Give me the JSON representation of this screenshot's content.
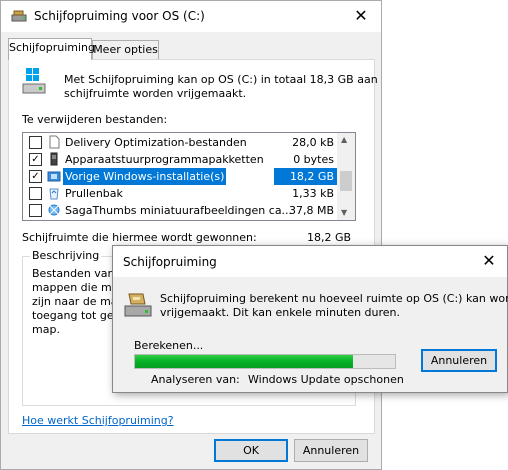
{
  "main_window": {
    "title": "Schijfopruiming voor OS (C:)",
    "tabs": [
      {
        "label": "Schijfopruiming",
        "active": true
      },
      {
        "label": "Meer opties",
        "active": false
      }
    ],
    "intro_text_line1": "Met Schijfopruiming kan op OS (C:) in totaal 18,3 GB aan",
    "intro_text_line2": "schijfruimte worden vrijgemaakt.",
    "files_label": "Te verwijderen bestanden:",
    "files": [
      {
        "name": "Delivery Optimization-bestanden",
        "size": "28,0 kB",
        "checked": false,
        "selected": false,
        "icon": "file-icon"
      },
      {
        "name": "Apparaatstuurprogrammapakketten",
        "size": "0 bytes",
        "checked": true,
        "selected": false,
        "icon": "device-icon"
      },
      {
        "name": "Vorige Windows-installatie(s)",
        "size": "18,2 GB",
        "checked": true,
        "selected": true,
        "icon": "windows-setup-icon"
      },
      {
        "name": "Prullenbak",
        "size": "1,33 kB",
        "checked": false,
        "selected": false,
        "icon": "recycle-bin-icon"
      },
      {
        "name": "SagaThumbs miniatuurafbeeldingen ca...",
        "size": "37,8 MB",
        "checked": false,
        "selected": false,
        "icon": "thumbnail-icon"
      }
    ],
    "gained_label": "Schijfruimte die hiermee wordt gewonnen:",
    "gained_value": "18,2 GB",
    "description_group": "Beschrijving",
    "description_lines": [
      "Bestanden van e",
      "mappen die moge",
      "zijn naar de map",
      "toegang tot gege",
      "map."
    ],
    "help_link": "Hoe werkt Schijfopruiming?",
    "ok_label": "OK",
    "cancel_label": "Annuleren"
  },
  "dialog": {
    "title": "Schijfopruiming",
    "message_line1": "Schijfopruiming berekent nu hoeveel ruimte op OS (C:) kan worden",
    "message_line2": "vrijgemaakt. Dit kan enkele minuten duren.",
    "progress_label": "Berekenen...",
    "progress_fraction": 0.84,
    "cancel_label": "Annuleren",
    "analyzing_label": "Analyseren van:",
    "analyzing_value": "Windows Update opschonen"
  },
  "colors": {
    "selection": "#0078d7",
    "progress": "#06b025",
    "link": "#0066cc"
  }
}
